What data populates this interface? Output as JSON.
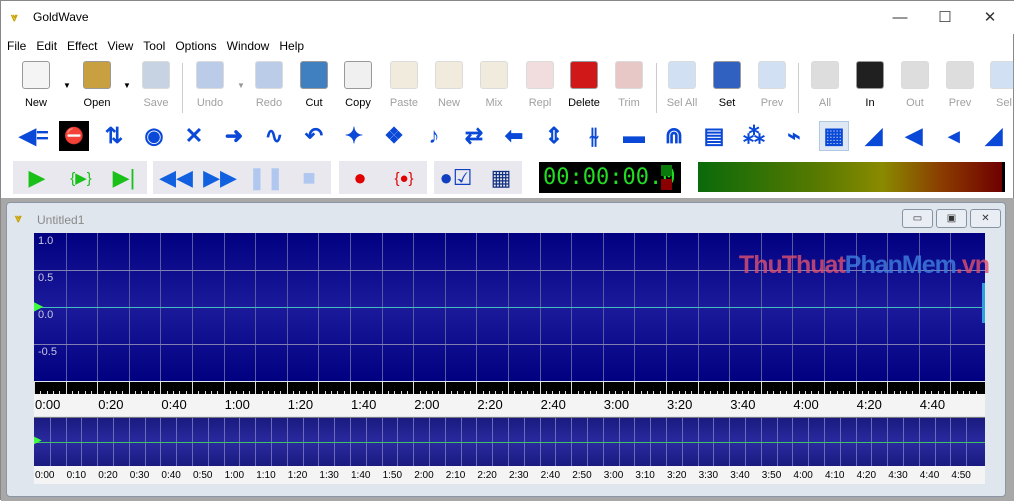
{
  "app": {
    "title": "GoldWave"
  },
  "window_controls": {
    "minimize": "—",
    "maximize": "☐",
    "close": "✕"
  },
  "menu": [
    "File",
    "Edit",
    "Effect",
    "View",
    "Tool",
    "Options",
    "Window",
    "Help"
  ],
  "toolbar1": [
    {
      "label": "New",
      "icon": "new-file-icon",
      "enabled": true,
      "color": "#f4f4f4"
    },
    {
      "label": "Open",
      "icon": "open-folder-icon",
      "enabled": true,
      "color": "#c8a040"
    },
    {
      "label": "Save",
      "icon": "save-disk-icon",
      "enabled": false,
      "color": "#6080b0"
    },
    {
      "label": "Undo",
      "icon": "undo-icon",
      "enabled": false,
      "color": "#4070c0"
    },
    {
      "label": "Redo",
      "icon": "redo-icon",
      "enabled": false,
      "color": "#4070c0"
    },
    {
      "label": "Cut",
      "icon": "scissors-icon",
      "enabled": true,
      "color": "#4080c0"
    },
    {
      "label": "Copy",
      "icon": "copy-icon",
      "enabled": true,
      "color": "#f0f0f0"
    },
    {
      "label": "Paste",
      "icon": "paste-icon",
      "enabled": false,
      "color": "#d8c8a0"
    },
    {
      "label": "New",
      "icon": "paste-new-icon",
      "enabled": false,
      "color": "#d8c8a0"
    },
    {
      "label": "Mix",
      "icon": "mix-icon",
      "enabled": false,
      "color": "#d8c8a0"
    },
    {
      "label": "Repl",
      "icon": "replace-icon",
      "enabled": false,
      "color": "#d8a0a0"
    },
    {
      "label": "Delete",
      "icon": "delete-x-icon",
      "enabled": true,
      "color": "#d01818"
    },
    {
      "label": "Trim",
      "icon": "trim-icon",
      "enabled": false,
      "color": "#c06060"
    },
    {
      "label": "Sel All",
      "icon": "select-all-icon",
      "enabled": false,
      "color": "#80a8e0"
    },
    {
      "label": "Set",
      "icon": "set-selection-icon",
      "enabled": true,
      "color": "#3060c0"
    },
    {
      "label": "Prev",
      "icon": "previous-selection-icon",
      "enabled": false,
      "color": "#80a8e0"
    },
    {
      "label": "All",
      "icon": "zoom-all-icon",
      "enabled": false,
      "color": "#a0a0a0"
    },
    {
      "label": "In",
      "icon": "zoom-in-icon",
      "enabled": true,
      "color": "#202020"
    },
    {
      "label": "Out",
      "icon": "zoom-out-icon",
      "enabled": false,
      "color": "#a0a0a0"
    },
    {
      "label": "Prev",
      "icon": "zoom-previous-icon",
      "enabled": false,
      "color": "#a0a0a0"
    },
    {
      "label": "Sel",
      "icon": "zoom-selection-icon",
      "enabled": false,
      "color": "#80a8e0"
    }
  ],
  "toolbar2": [
    {
      "icon": "channel-left-icon",
      "glyph": "◀="
    },
    {
      "icon": "no-entry-icon",
      "glyph": "⛔"
    },
    {
      "icon": "expand-compress-icon",
      "glyph": "⇅"
    },
    {
      "icon": "doppler-icon",
      "glyph": "◉"
    },
    {
      "icon": "crossfade-icon",
      "glyph": "✕"
    },
    {
      "icon": "dynamics-icon",
      "glyph": "➜"
    },
    {
      "icon": "echo-wave-icon",
      "glyph": "∿"
    },
    {
      "icon": "reverse-icon",
      "glyph": "↶"
    },
    {
      "icon": "noise-reduction-icon",
      "glyph": "✦"
    },
    {
      "icon": "mechanize-icon",
      "glyph": "❖"
    },
    {
      "icon": "pitch-note-icon",
      "glyph": "♪"
    },
    {
      "icon": "playback-rate-icon",
      "glyph": "⇄"
    },
    {
      "icon": "reverse-arrow-icon",
      "glyph": "⬅"
    },
    {
      "icon": "offset-icon",
      "glyph": "⇕"
    },
    {
      "icon": "equalizer-icon",
      "glyph": "⫳"
    },
    {
      "icon": "filter-spectrum-icon",
      "glyph": "▬"
    },
    {
      "icon": "reverb-icon",
      "glyph": "⋒"
    },
    {
      "icon": "spectrum-filter-icon",
      "glyph": "▤"
    },
    {
      "icon": "pop-click-icon",
      "glyph": "⁂"
    },
    {
      "icon": "silence-reduction-icon",
      "glyph": "⌁"
    },
    {
      "icon": "volume-shape-icon",
      "glyph": "▦"
    },
    {
      "icon": "fade-in-icon",
      "glyph": "◢"
    },
    {
      "icon": "volume-icon",
      "glyph": "◀"
    },
    {
      "icon": "volume-change-icon",
      "glyph": "◂"
    },
    {
      "icon": "maximize-volume-icon",
      "glyph": "◢"
    }
  ],
  "transport": [
    {
      "icon": "play-icon",
      "glyph": "▶",
      "color": "#18c018"
    },
    {
      "icon": "play-selection-icon",
      "glyph": "{▶}",
      "color": "#18c018"
    },
    {
      "icon": "play-to-end-icon",
      "glyph": "▶|",
      "color": "#18c018"
    },
    {
      "icon": "rewind-icon",
      "glyph": "◀◀",
      "color": "#1060e0"
    },
    {
      "icon": "fast-forward-icon",
      "glyph": "▶▶",
      "color": "#1060e0"
    },
    {
      "icon": "pause-icon",
      "glyph": "❚❚",
      "color": "#b0c8f0"
    },
    {
      "icon": "stop-icon",
      "glyph": "■",
      "color": "#b0c8f0"
    },
    {
      "icon": "record-new-icon",
      "glyph": "●",
      "color": "#e00000"
    },
    {
      "icon": "record-selection-icon",
      "glyph": "{●}",
      "color": "#e00000"
    },
    {
      "icon": "control-properties-icon",
      "glyph": "●☑",
      "color": "#1040c0"
    },
    {
      "icon": "device-controls-icon",
      "glyph": "▦",
      "color": "#103080"
    }
  ],
  "timer": "00:00:00.0",
  "document": {
    "title": "Untitled1",
    "y_labels": [
      "1.0",
      "0.5",
      "0.0",
      "-0.5"
    ],
    "time_labels": [
      "0:00",
      "0:20",
      "0:40",
      "1:00",
      "1:20",
      "1:40",
      "2:00",
      "2:20",
      "2:40",
      "3:00",
      "3:20",
      "3:40",
      "4:00",
      "4:20",
      "4:40"
    ],
    "overview_labels": [
      "0:00",
      "0:10",
      "0:20",
      "0:30",
      "0:40",
      "0:50",
      "1:00",
      "1:10",
      "1:20",
      "1:30",
      "1:40",
      "1:50",
      "2:00",
      "2:10",
      "2:20",
      "2:30",
      "2:40",
      "2:50",
      "3:00",
      "3:10",
      "3:20",
      "3:30",
      "3:40",
      "3:50",
      "4:00",
      "4:10",
      "4:20",
      "4:30",
      "4:40",
      "4:50"
    ]
  },
  "watermark": {
    "part1": "ThuThuat",
    "part2": "PhanMem",
    "part3": ".vn"
  }
}
